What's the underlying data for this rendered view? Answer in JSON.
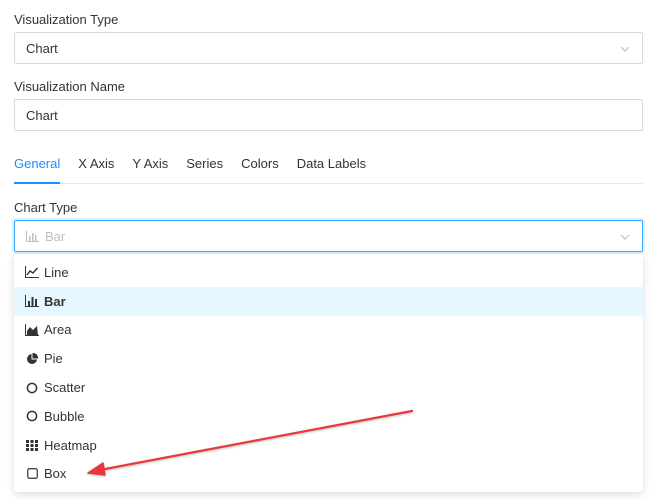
{
  "form": {
    "viz_type_label": "Visualization Type",
    "viz_type_value": "Chart",
    "viz_name_label": "Visualization Name",
    "viz_name_value": "Chart"
  },
  "tabs": [
    {
      "label": "General",
      "active": true
    },
    {
      "label": "X Axis"
    },
    {
      "label": "Y Axis"
    },
    {
      "label": "Series"
    },
    {
      "label": "Colors"
    },
    {
      "label": "Data Labels"
    }
  ],
  "chart_type": {
    "label": "Chart Type",
    "placeholder_value": "Bar",
    "options": [
      {
        "label": "Line",
        "icon": "line-chart-icon"
      },
      {
        "label": "Bar",
        "icon": "bar-chart-icon",
        "selected": true
      },
      {
        "label": "Area",
        "icon": "area-chart-icon"
      },
      {
        "label": "Pie",
        "icon": "pie-chart-icon"
      },
      {
        "label": "Scatter",
        "icon": "scatter-circle-icon"
      },
      {
        "label": "Bubble",
        "icon": "bubble-circle-icon"
      },
      {
        "label": "Heatmap",
        "icon": "heatmap-grid-icon"
      },
      {
        "label": "Box",
        "icon": "box-square-icon"
      }
    ]
  },
  "colors": {
    "accent": "#1890ff",
    "selected_bg": "#e6f7ff",
    "annotation_arrow": "#e8383d"
  }
}
